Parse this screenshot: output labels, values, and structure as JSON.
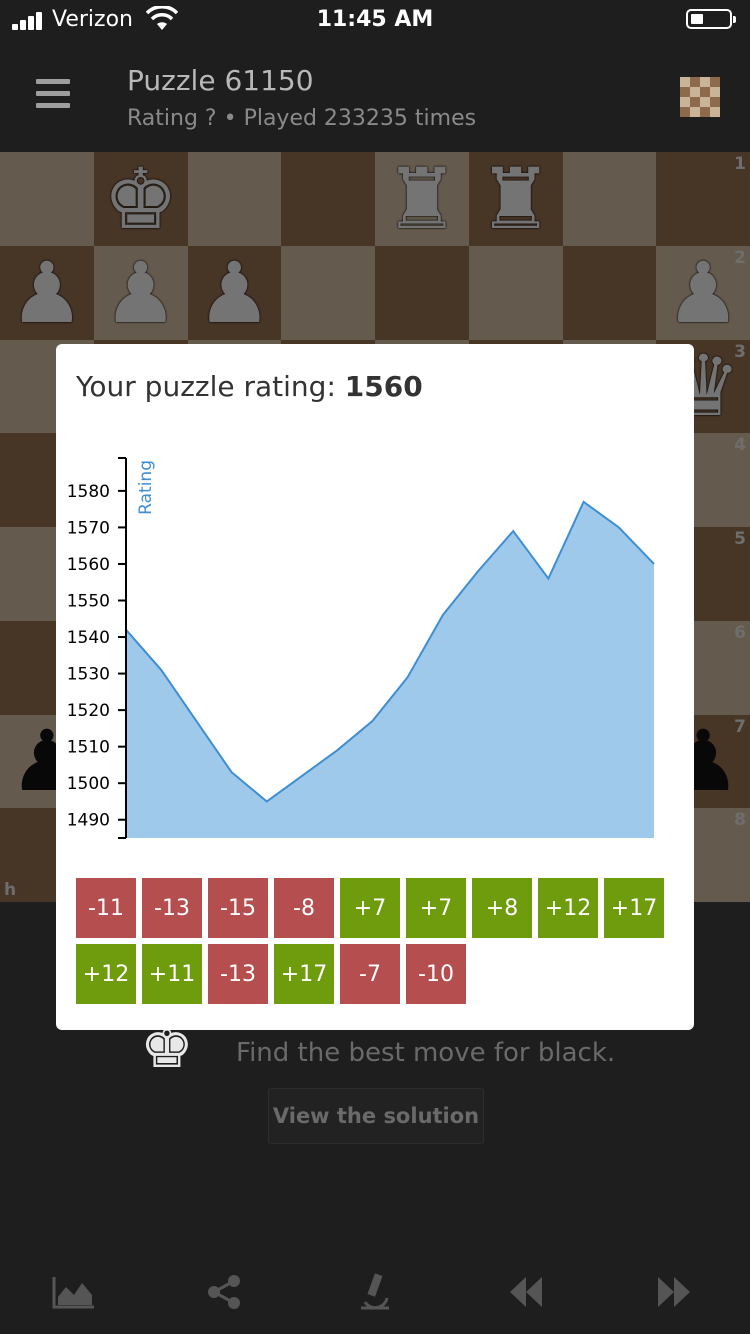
{
  "status_bar": {
    "carrier": "Verizon",
    "time": "11:45 AM"
  },
  "header": {
    "title": "Puzzle 61150",
    "subtitle": "Rating ? • Played 233235 times"
  },
  "board": {
    "ranks": [
      "1",
      "2",
      "3",
      "4",
      "5",
      "6",
      "7",
      "8"
    ],
    "file_label": "h",
    "pieces": [
      {
        "row": 0,
        "col": 1,
        "glyph": "♚",
        "color": "w"
      },
      {
        "row": 0,
        "col": 4,
        "glyph": "♜",
        "color": "w"
      },
      {
        "row": 0,
        "col": 5,
        "glyph": "♜",
        "color": "w"
      },
      {
        "row": 1,
        "col": 0,
        "glyph": "♟",
        "color": "w"
      },
      {
        "row": 1,
        "col": 1,
        "glyph": "♟",
        "color": "w"
      },
      {
        "row": 1,
        "col": 2,
        "glyph": "♟",
        "color": "w"
      },
      {
        "row": 1,
        "col": 7,
        "glyph": "♟",
        "color": "w"
      },
      {
        "row": 2,
        "col": 7,
        "glyph": "♛",
        "color": "w"
      },
      {
        "row": 6,
        "col": 0,
        "glyph": "♟",
        "color": "b"
      },
      {
        "row": 6,
        "col": 7,
        "glyph": "♟",
        "color": "b"
      }
    ]
  },
  "hint": {
    "text": "Find the best move for black.",
    "piece_glyph": "♚"
  },
  "solution_button": {
    "label": "View the solution"
  },
  "toolbar": {
    "icons": [
      "chart-icon",
      "share-icon",
      "analysis-icon",
      "previous-icon",
      "next-icon"
    ]
  },
  "modal": {
    "title_prefix": "Your puzzle rating: ",
    "rating": "1560",
    "chart_data": {
      "type": "area",
      "title": "",
      "xlabel": "",
      "ylabel": "Rating",
      "ylim": [
        1485,
        1589
      ],
      "yticks": [
        1490,
        1500,
        1510,
        1520,
        1530,
        1540,
        1550,
        1560,
        1570,
        1580
      ],
      "values": [
        1542,
        1531,
        1517,
        1503,
        1495,
        1502,
        1509,
        1517,
        1529,
        1546,
        1558,
        1569,
        1556,
        1577,
        1570,
        1560
      ],
      "fill_color": "#9fc9ea",
      "line_color": "#3f8ed1"
    },
    "recent_results": [
      "-11",
      "-13",
      "-15",
      "-8",
      "+7",
      "+7",
      "+8",
      "+12",
      "+17",
      "+12",
      "+11",
      "-13",
      "+17",
      "-7",
      "-10"
    ]
  },
  "colors": {
    "loss": "#b54f4f",
    "win": "#6f9c0c",
    "light_square": "#c9b49a",
    "dark_square": "#8e6a4d"
  }
}
